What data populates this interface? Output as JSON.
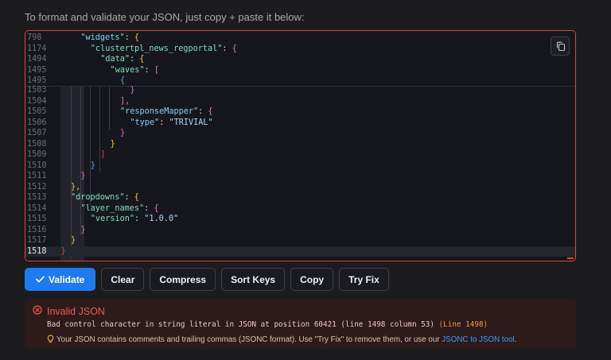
{
  "intro_text": "To format and validate your JSON, just copy + paste it below:",
  "editor": {
    "lines": [
      {
        "n": "798",
        "indent": 1,
        "segs": [
          [
            "k",
            "\"widgets\""
          ],
          [
            "p",
            ": "
          ],
          [
            "b1",
            "{"
          ]
        ]
      },
      {
        "n": "1174",
        "indent": 2,
        "segs": [
          [
            "ks",
            "\"clustertpl_news_regportal\""
          ],
          [
            "p",
            ": "
          ],
          [
            "b2",
            "{"
          ]
        ]
      },
      {
        "n": "1494",
        "indent": 3,
        "segs": [
          [
            "ks",
            "\"data\""
          ],
          [
            "p",
            ": "
          ],
          [
            "b1",
            "{"
          ]
        ]
      },
      {
        "n": "1495",
        "indent": 4,
        "segs": [
          [
            "ks",
            "\"waves\""
          ],
          [
            "p",
            ": "
          ],
          [
            "b2",
            "["
          ]
        ]
      },
      {
        "n": "1495",
        "indent": 5,
        "segs": [
          [
            "b3",
            "{"
          ]
        ]
      },
      {
        "n": "1503",
        "indent": 6,
        "segs": [
          [
            "b2",
            "}"
          ]
        ]
      },
      {
        "n": "1504",
        "indent": 5,
        "segs": [
          [
            "b2",
            "],"
          ]
        ]
      },
      {
        "n": "1505",
        "indent": 5,
        "segs": [
          [
            "k",
            "\"responseMapper\""
          ],
          [
            "p",
            ": "
          ],
          [
            "b2",
            "{"
          ]
        ]
      },
      {
        "n": "1506",
        "indent": 6,
        "segs": [
          [
            "k",
            "\"type\""
          ],
          [
            "p",
            ": "
          ],
          [
            "s",
            "\"TRIVIAL\""
          ]
        ]
      },
      {
        "n": "1507",
        "indent": 5,
        "segs": [
          [
            "b2",
            "}"
          ]
        ]
      },
      {
        "n": "1508",
        "indent": 4,
        "segs": [
          [
            "b1",
            "}"
          ]
        ]
      },
      {
        "n": "1509",
        "indent": 3,
        "segs": [
          [
            "b4",
            "]"
          ]
        ]
      },
      {
        "n": "1510",
        "indent": 2,
        "segs": [
          [
            "b3",
            "}"
          ]
        ]
      },
      {
        "n": "1511",
        "indent": 1,
        "segs": [
          [
            "b2",
            "}"
          ]
        ]
      },
      {
        "n": "1512",
        "indent": 0,
        "segs": [
          [
            "b1",
            "},"
          ]
        ]
      },
      {
        "n": "1513",
        "indent": 0,
        "segs": [
          [
            "ks",
            "\"dropdowns\""
          ],
          [
            "p",
            ": "
          ],
          [
            "b1",
            "{"
          ]
        ]
      },
      {
        "n": "1514",
        "indent": 1,
        "segs": [
          [
            "ks",
            "\"layer_names\""
          ],
          [
            "p",
            ": "
          ],
          [
            "b2",
            "{"
          ]
        ]
      },
      {
        "n": "1515",
        "indent": 2,
        "segs": [
          [
            "ks",
            "\"version\""
          ],
          [
            "p",
            ": "
          ],
          [
            "s",
            "\"1.0.0\""
          ]
        ]
      },
      {
        "n": "1516",
        "indent": 1,
        "segs": [
          [
            "b2",
            "}"
          ]
        ]
      },
      {
        "n": "1517",
        "indent": 0,
        "segs": [
          [
            "b1",
            "}"
          ]
        ]
      },
      {
        "n": "1518",
        "indent": -1,
        "segs": [
          [
            "b4",
            "}"
          ]
        ],
        "active": true
      }
    ]
  },
  "toolbar": {
    "validate": "Validate",
    "clear": "Clear",
    "compress": "Compress",
    "sort_keys": "Sort Keys",
    "copy": "Copy",
    "try_fix": "Try Fix"
  },
  "error": {
    "title": "Invalid JSON",
    "message": "Bad control character in string literal in JSON at position 60421 (line 1498 column 53)",
    "line_ref": "(Line 1498)",
    "hint_text": "Your JSON contains comments and trailing commas (JSONC format). Use \"Try Fix\" to remove them, or use our ",
    "hint_link": "JSONC to JSON tool",
    "hint_end": "."
  },
  "colors": {
    "accent": "#1f7af0",
    "error": "#e0433c",
    "warning": "#f29b3c"
  }
}
